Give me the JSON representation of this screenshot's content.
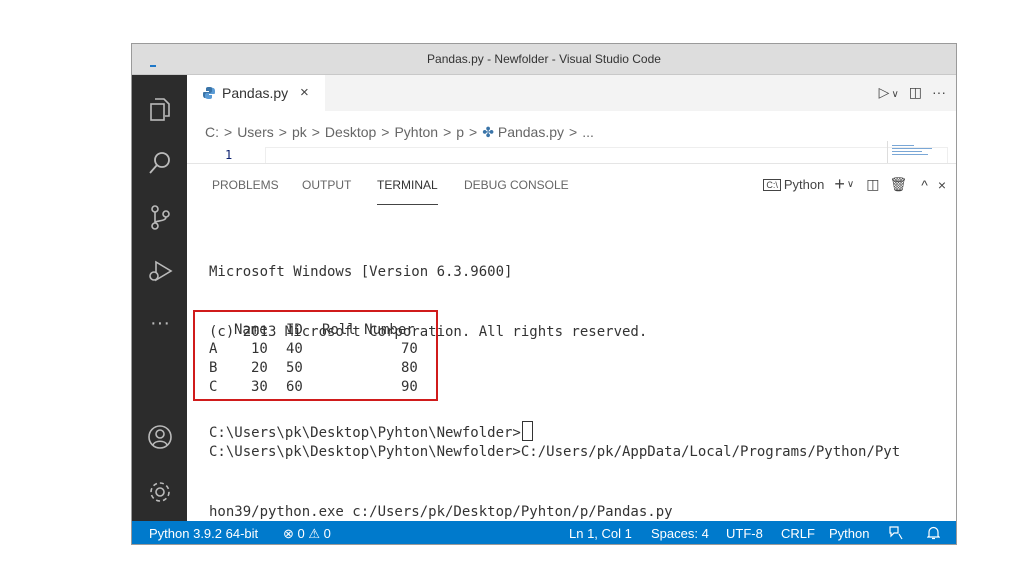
{
  "window": {
    "title": "Pandas.py - Newfolder - Visual Studio Code"
  },
  "activity_bar": [
    "explorer-icon",
    "search-icon",
    "source-control-icon",
    "run-debug-icon",
    "more-icon",
    "account-icon",
    "settings-gear-icon"
  ],
  "tab": {
    "file_name": "Pandas.py",
    "close": "×"
  },
  "tab_actions": {
    "run": "▷",
    "chevron": "∨",
    "split": "◫",
    "more": "···"
  },
  "breadcrumb": [
    "C:",
    "Users",
    "pk",
    "Desktop",
    "Pyhton",
    "p",
    "Pandas.py",
    "..."
  ],
  "editor": {
    "line_number": "1"
  },
  "panel": {
    "tabs": [
      "PROBLEMS",
      "OUTPUT",
      "TERMINAL",
      "DEBUG CONSOLE"
    ],
    "active_tab": "TERMINAL",
    "shell": "Python",
    "actions": {
      "add": "+",
      "chevron": "∨",
      "split": "◫",
      "trash": "🗑",
      "maximize": "^",
      "close": "×"
    }
  },
  "terminal": {
    "lines": [
      "Microsoft Windows [Version 6.3.9600]",
      "(c) 2013 Microsoft Corporation. All rights reserved.",
      "",
      "C:\\Users\\pk\\Desktop\\Pyhton\\Newfolder>C:/Users/pk/AppData/Local/Programs/Python/Pyt",
      "hon39/python.exe c:/Users/pk/Desktop/Pyhton/p/Pandas.py"
    ],
    "table": {
      "header": [
        "",
        "Name",
        "ID",
        "Roll Number"
      ],
      "rows": [
        [
          "A",
          "10",
          "40",
          "70"
        ],
        [
          "B",
          "20",
          "50",
          "80"
        ],
        [
          "C",
          "30",
          "60",
          "90"
        ]
      ]
    },
    "prompt": "C:\\Users\\pk\\Desktop\\Pyhton\\Newfolder>"
  },
  "statusbar": {
    "interpreter": "Python 3.9.2 64-bit",
    "errors": "⊗ 0",
    "warnings": "⚠ 0",
    "position": "Ln 1, Col 1",
    "spaces": "Spaces: 4",
    "encoding": "UTF-8",
    "eol": "CRLF",
    "language": "Python"
  },
  "colors": {
    "activity_bar": "#2c2c2c",
    "statusbar": "#007acc",
    "highlight_box": "#d01b1b"
  }
}
